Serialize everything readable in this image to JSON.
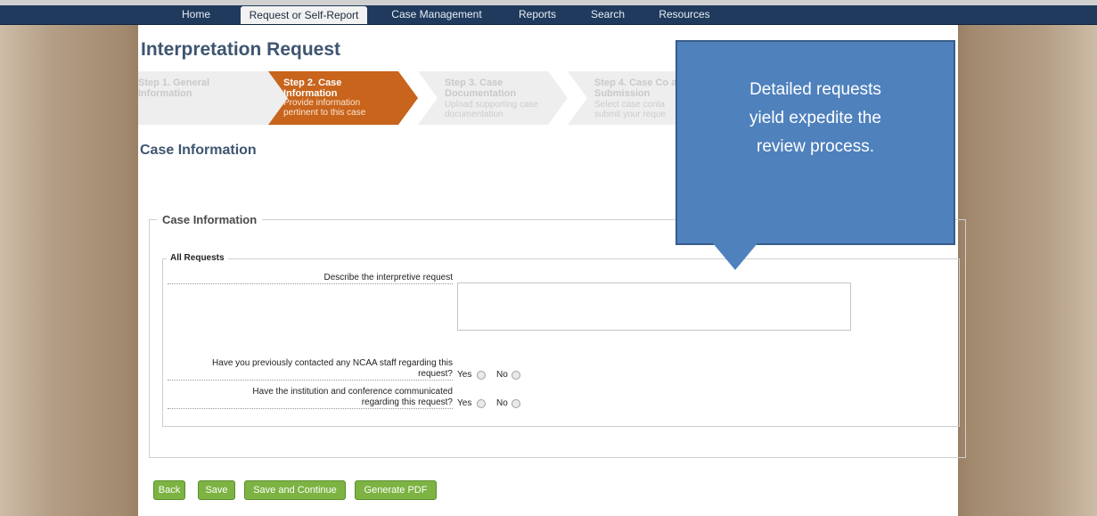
{
  "nav": {
    "items": [
      "Home",
      "Request or Self-Report",
      "Case Management",
      "Reports",
      "Search",
      "Resources"
    ],
    "active": "Request or Self-Report"
  },
  "page": {
    "title": "Interpretation Request",
    "section_title": "Case Information"
  },
  "steps": [
    {
      "title": "Step 1. General Information",
      "desc": ""
    },
    {
      "title": "Step 2. Case Information",
      "desc": "Provide information pertinent to this case"
    },
    {
      "title": "Step 3. Case Documentation",
      "desc": "Upload supporting case documentation"
    },
    {
      "title": "Step 4. Case Co and Submission",
      "desc": "Select case conta submit your reque"
    }
  ],
  "form": {
    "fieldset_legend": "Case Information",
    "inner_legend": "All Requests",
    "describe_label": "Describe the interpretive request",
    "describe_value": "",
    "q1_label_line1": "Have you previously contacted any NCAA staff regarding this",
    "q1_label_line2": "request?",
    "q2_label_line1": "Have the institution and conference communicated",
    "q2_label_line2": "regarding this request?",
    "yes": "Yes",
    "no": "No"
  },
  "buttons": {
    "back": "Back",
    "save": "Save",
    "save_continue": "Save and Continue",
    "pdf": "Generate PDF"
  },
  "callout": {
    "line1": "Detailed requests",
    "line2": "yield expedite the",
    "line3": "review process."
  },
  "colors": {
    "nav_bg": "#1f3a5c",
    "active_step": "#c8641c",
    "button_green": "#7cb342",
    "callout_blue": "#4f81bd",
    "title_color": "#3e5570"
  }
}
